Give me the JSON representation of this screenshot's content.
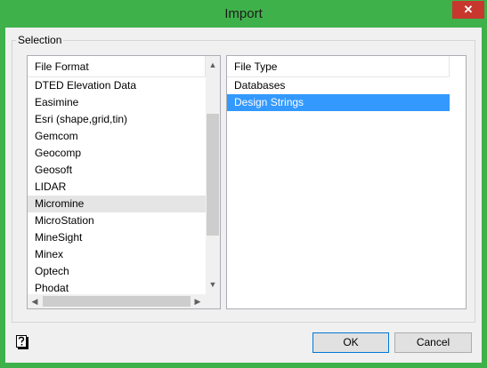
{
  "window": {
    "title": "Import",
    "close_glyph": "✕"
  },
  "selection": {
    "legend": "Selection"
  },
  "file_format": {
    "header": "File Format",
    "items": [
      "DTED Elevation Data",
      "Easimine",
      "Esri (shape,grid,tin)",
      "Gemcom",
      "Geocomp",
      "Geosoft",
      "LIDAR",
      "Micromine",
      "MicroStation",
      "MineSight",
      "Minex",
      "Optech",
      "Phodat"
    ],
    "highlighted": "Micromine"
  },
  "file_type": {
    "header": "File Type",
    "items": [
      "Databases",
      "Design Strings"
    ],
    "selected": "Design Strings"
  },
  "scrollbar": {
    "up": "▲",
    "down": "▼",
    "left": "◀",
    "right": "▶"
  },
  "buttons": {
    "ok": "OK",
    "cancel": "Cancel"
  },
  "icons": {
    "help": "help-icon"
  },
  "colors": {
    "title_bar": "#3fb14a",
    "selection": "#3399ff",
    "close": "#c7372e"
  }
}
